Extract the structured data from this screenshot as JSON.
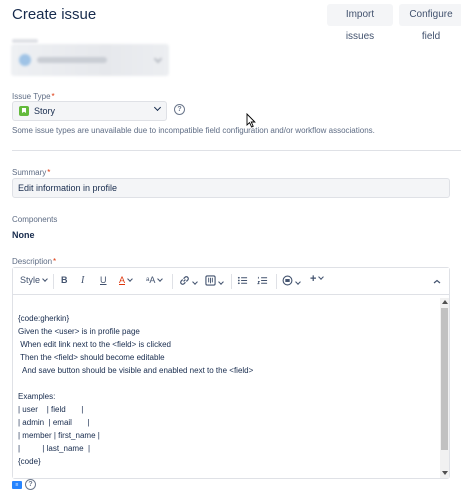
{
  "header": {
    "title": "Create issue",
    "import_label": "Import issues",
    "configure_label": "Configure field"
  },
  "issue_type": {
    "label": "Issue Type",
    "required_mark": "*",
    "value": "Story",
    "hint": "Some issue types are unavailable due to incompatible field configuration and/or workflow associations."
  },
  "summary": {
    "label": "Summary",
    "required_mark": "*",
    "value": "Edit information in profile"
  },
  "components": {
    "label": "Components",
    "value": "None"
  },
  "description": {
    "label": "Description",
    "required_mark": "*",
    "toolbar": {
      "style_label": "Style",
      "bold": "B",
      "italic": "I",
      "underline": "U",
      "text_color": "A",
      "text_size": "ᵃA",
      "link": "🔗",
      "attachment": "▣",
      "bullet_list": "☰",
      "numbered_list": "☰",
      "emoji": "☺",
      "insert": "+",
      "collapse": "⌃"
    },
    "lines": [
      "{code:gherkin}",
      "Given the <user> is in profile page",
      " When edit link next to the <field> is clicked",
      " Then the <field> should become editable",
      "  And save button should be visible and enabled next to the <field>",
      "",
      "Examples:",
      "| user    | field       |",
      "| admin  | email       |",
      "| member | first_name |",
      "|          | last_name  |",
      "{code}"
    ]
  },
  "colors": {
    "accent": "#0052cc",
    "required": "#de350b",
    "story": "#63ba3c",
    "field_bg": "#f4f5f7"
  },
  "icons": {
    "help": "question-circle-icon",
    "story": "story-icon",
    "footer": "wiki-markup-icon"
  }
}
